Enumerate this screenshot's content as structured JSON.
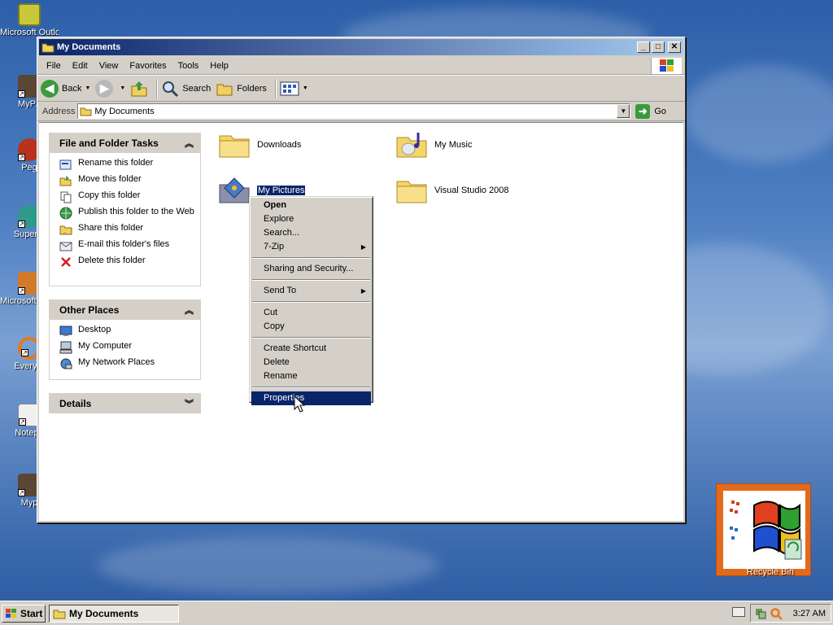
{
  "desktop": {
    "icons": [
      {
        "label": "Microsoft Outlook",
        "icon": "outlook-icon"
      },
      {
        "label": "MyPa",
        "icon": "app-icon"
      },
      {
        "label": "Peg",
        "icon": "ball-icon"
      },
      {
        "label": "Superm",
        "icon": "app-icon"
      },
      {
        "label": "Microsoft Studio",
        "icon": "studio-icon"
      },
      {
        "label": "Everyth",
        "icon": "search-icon"
      },
      {
        "label": "Notepa",
        "icon": "notepad-icon"
      },
      {
        "label": "Myp",
        "icon": "app-icon"
      }
    ],
    "recycle_bin": "Recycle Bin"
  },
  "window": {
    "title": "My Documents",
    "controls": {
      "minimize": "_",
      "maximize": "□",
      "close": "✕"
    },
    "menu": [
      "File",
      "Edit",
      "View",
      "Favorites",
      "Tools",
      "Help"
    ],
    "toolbar": {
      "back": "Back",
      "search": "Search",
      "folders": "Folders"
    },
    "address": {
      "label": "Address",
      "value": "My Documents",
      "go": "Go"
    }
  },
  "task_pane": {
    "file_tasks": {
      "title": "File and Folder Tasks",
      "items": [
        {
          "label": "Rename this folder",
          "icon": "rename-icon"
        },
        {
          "label": "Move this folder",
          "icon": "move-icon"
        },
        {
          "label": "Copy this folder",
          "icon": "copy-icon"
        },
        {
          "label": "Publish this folder to the Web",
          "icon": "globe-icon"
        },
        {
          "label": "Share this folder",
          "icon": "share-icon"
        },
        {
          "label": "E-mail this folder's files",
          "icon": "email-icon"
        },
        {
          "label": "Delete this folder",
          "icon": "delete-icon"
        }
      ]
    },
    "other_places": {
      "title": "Other Places",
      "items": [
        {
          "label": "Desktop",
          "icon": "desktop-icon"
        },
        {
          "label": "My Computer",
          "icon": "computer-icon"
        },
        {
          "label": "My Network Places",
          "icon": "network-icon"
        }
      ]
    },
    "details": {
      "title": "Details"
    }
  },
  "folders": [
    {
      "label": "Downloads",
      "icon": "folder-icon"
    },
    {
      "label": "My Music",
      "icon": "music-folder-icon"
    },
    {
      "label": "My Pictures",
      "icon": "pictures-folder-icon",
      "selected": true
    },
    {
      "label": "Visual Studio 2008",
      "icon": "folder-icon"
    }
  ],
  "context_menu": {
    "items": [
      {
        "label": "Open"
      },
      {
        "label": "Explore"
      },
      {
        "label": "Search..."
      },
      {
        "label": "7-Zip"
      },
      {
        "label": "Sharing and Security..."
      },
      {
        "label": "Send To"
      },
      {
        "label": "Cut"
      },
      {
        "label": "Copy"
      },
      {
        "label": "Create Shortcut"
      },
      {
        "label": "Delete"
      },
      {
        "label": "Rename"
      },
      {
        "label": "Properties"
      }
    ],
    "highlighted": "Properties"
  },
  "taskbar": {
    "start": "Start",
    "task": "My Documents",
    "clock": "3:27 AM"
  },
  "colors": {
    "selection": "#0a246a",
    "desktop": "#3a6aad",
    "chrome": "#d4d0c8",
    "recycle_frame": "#e36a1c"
  }
}
